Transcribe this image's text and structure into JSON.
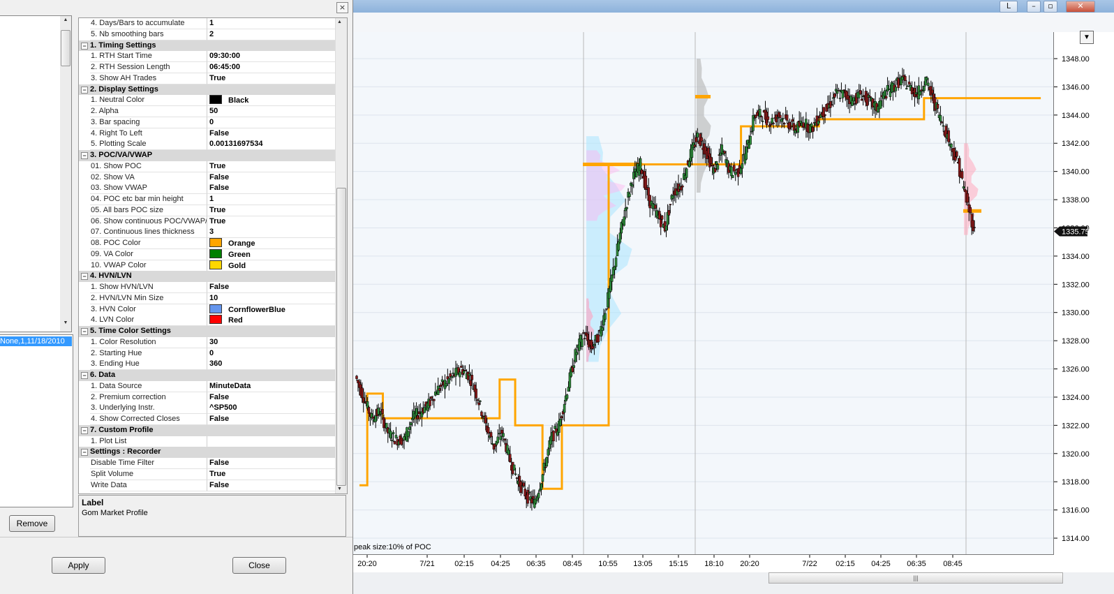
{
  "dialog": {
    "close_glyph": "×",
    "selected_item": "None,1,11/18/2010",
    "remove_label": "Remove",
    "apply_label": "Apply",
    "close_label": "Close",
    "label_title": "Label",
    "label_value": "Gom Market Profile"
  },
  "properties": [
    {
      "kind": "prop",
      "name": "4. Days/Bars to accumulate",
      "value": "1"
    },
    {
      "kind": "prop",
      "name": "5. Nb smoothing bars",
      "value": "2"
    },
    {
      "kind": "cat",
      "name": "1. Timing Settings"
    },
    {
      "kind": "prop",
      "name": "1. RTH Start Time",
      "value": "09:30:00"
    },
    {
      "kind": "prop",
      "name": "2. RTH Session Length",
      "value": "06:45:00"
    },
    {
      "kind": "prop",
      "name": "3. Show AH Trades",
      "value": "True"
    },
    {
      "kind": "cat",
      "name": "2. Display Settings"
    },
    {
      "kind": "prop",
      "name": "1. Neutral Color",
      "value": "Black",
      "swatch": "#000000"
    },
    {
      "kind": "prop",
      "name": "2. Alpha",
      "value": "50"
    },
    {
      "kind": "prop",
      "name": "3. Bar spacing",
      "value": "0"
    },
    {
      "kind": "prop",
      "name": "4. Right To Left",
      "value": "False"
    },
    {
      "kind": "prop",
      "name": "5. Plotting Scale",
      "value": "0.00131697534"
    },
    {
      "kind": "cat",
      "name": "3. POC/VA/VWAP"
    },
    {
      "kind": "prop",
      "name": "01. Show POC",
      "value": "True"
    },
    {
      "kind": "prop",
      "name": "02. Show VA",
      "value": "False"
    },
    {
      "kind": "prop",
      "name": "03. Show VWAP",
      "value": "False"
    },
    {
      "kind": "prop",
      "name": "04. POC etc bar min height",
      "value": "1"
    },
    {
      "kind": "prop",
      "name": "05. All bars POC size",
      "value": "True"
    },
    {
      "kind": "prop",
      "name": "06. Show continuous POC/VWAP/",
      "value": "True"
    },
    {
      "kind": "prop",
      "name": "07. Continuous lines thickness",
      "value": "3"
    },
    {
      "kind": "prop",
      "name": "08. POC Color",
      "value": "Orange",
      "swatch": "#ffa500"
    },
    {
      "kind": "prop",
      "name": "09. VA Color",
      "value": "Green",
      "swatch": "#008000"
    },
    {
      "kind": "prop",
      "name": "10. VWAP Color",
      "value": "Gold",
      "swatch": "#ffd700"
    },
    {
      "kind": "cat",
      "name": "4. HVN/LVN"
    },
    {
      "kind": "prop",
      "name": "1. Show HVN/LVN",
      "value": "False"
    },
    {
      "kind": "prop",
      "name": "2. HVN/LVN Min Size",
      "value": "10"
    },
    {
      "kind": "prop",
      "name": "3. HVN Color",
      "value": "CornflowerBlue",
      "swatch": "#6495ed"
    },
    {
      "kind": "prop",
      "name": "4. LVN Color",
      "value": "Red",
      "swatch": "#ff0000"
    },
    {
      "kind": "cat",
      "name": "5. Time Color Settings"
    },
    {
      "kind": "prop",
      "name": "1. Color Resolution",
      "value": "30"
    },
    {
      "kind": "prop",
      "name": "2. Starting Hue",
      "value": "0"
    },
    {
      "kind": "prop",
      "name": "3. Ending Hue",
      "value": "360"
    },
    {
      "kind": "cat",
      "name": "6. Data"
    },
    {
      "kind": "prop",
      "name": "1. Data Source",
      "value": "MinuteData"
    },
    {
      "kind": "prop",
      "name": "2. Premium correction",
      "value": "False"
    },
    {
      "kind": "prop",
      "name": "3. Underlying Instr.",
      "value": "^SP500"
    },
    {
      "kind": "prop",
      "name": "4. Show Corrected Closes",
      "value": "False"
    },
    {
      "kind": "cat",
      "name": "7. Custom Profile"
    },
    {
      "kind": "prop",
      "name": "1. Plot List",
      "value": ""
    },
    {
      "kind": "cat",
      "name": "Settings : Recorder"
    },
    {
      "kind": "prop",
      "name": "Disable Time Filter",
      "value": "False"
    },
    {
      "kind": "prop",
      "name": "Split Volume",
      "value": "True"
    },
    {
      "kind": "prop",
      "name": "Write Data",
      "value": "False"
    }
  ],
  "chart_window": {
    "button_l": "L",
    "btn_min": "–",
    "btn_restore": "▫",
    "btn_close": "✕",
    "dropdown_glyph": "▼",
    "scroll_grip": "|||",
    "peak_note": "peak size:10% of POC",
    "current_price": "1335.75",
    "accent_orange": "#ffa500"
  },
  "chart_data": {
    "type": "candlestick",
    "y_ticks": [
      "1314.00",
      "1316.00",
      "1318.00",
      "1320.00",
      "1322.00",
      "1324.00",
      "1326.00",
      "1328.00",
      "1330.00",
      "1332.00",
      "1334.00",
      "1336.00",
      "1338.00",
      "1340.00",
      "1342.00",
      "1344.00",
      "1346.00",
      "1348.00"
    ],
    "ylim": [
      1313,
      1349
    ],
    "x_ticks": [
      "20:20",
      "7/21",
      "02:15",
      "04:25",
      "06:35",
      "08:45",
      "10:55",
      "13:05",
      "15:15",
      "18:10",
      "20:20",
      "7/22",
      "02:15",
      "04:25",
      "06:35",
      "08:45"
    ],
    "close_path": [
      1325.5,
      1324.0,
      1322.5,
      1323.0,
      1321.5,
      1321.0,
      1321.0,
      1322.5,
      1323.0,
      1323.5,
      1324.5,
      1325.0,
      1325.5,
      1326.0,
      1325.5,
      1324.0,
      1322.0,
      1320.5,
      1321.5,
      1319.5,
      1318.0,
      1317.0,
      1316.5,
      1318.5,
      1321.0,
      1322.0,
      1324.5,
      1327.0,
      1328.5,
      1327.5,
      1328.5,
      1331.0,
      1334.0,
      1337.0,
      1339.5,
      1340.5,
      1338.0,
      1337.0,
      1336.0,
      1338.5,
      1339.0,
      1341.0,
      1342.5,
      1341.5,
      1340.0,
      1341.5,
      1340.0,
      1340.0,
      1341.5,
      1344.0,
      1344.0,
      1343.5,
      1344.0,
      1343.5,
      1343.0,
      1343.5,
      1343.0,
      1344.0,
      1344.5,
      1345.5,
      1345.5,
      1345.0,
      1345.5,
      1345.0,
      1344.5,
      1345.5,
      1346.0,
      1346.5,
      1346.0,
      1345.5,
      1346.5,
      1345.0,
      1343.5,
      1342.0,
      1340.5,
      1338.0,
      1335.75
    ],
    "poc_steps": [
      [
        0,
        1317.75
      ],
      [
        2,
        1317.75
      ],
      [
        2,
        1324.25
      ],
      [
        6,
        1324.25
      ],
      [
        6,
        1322.5
      ],
      [
        36,
        1322.5
      ],
      [
        36,
        1325.25
      ],
      [
        40,
        1325.25
      ],
      [
        40,
        1322.0
      ],
      [
        47,
        1322.0
      ],
      [
        47,
        1317.5
      ],
      [
        52,
        1317.5
      ],
      [
        52,
        1322.0
      ],
      [
        64,
        1322.0
      ],
      [
        64,
        1340.5
      ],
      [
        98,
        1340.5
      ],
      [
        98,
        1343.2
      ],
      [
        118,
        1343.2
      ],
      [
        118,
        1343.7
      ],
      [
        145,
        1343.7
      ],
      [
        145,
        1345.2
      ],
      [
        175,
        1345.2
      ]
    ]
  }
}
